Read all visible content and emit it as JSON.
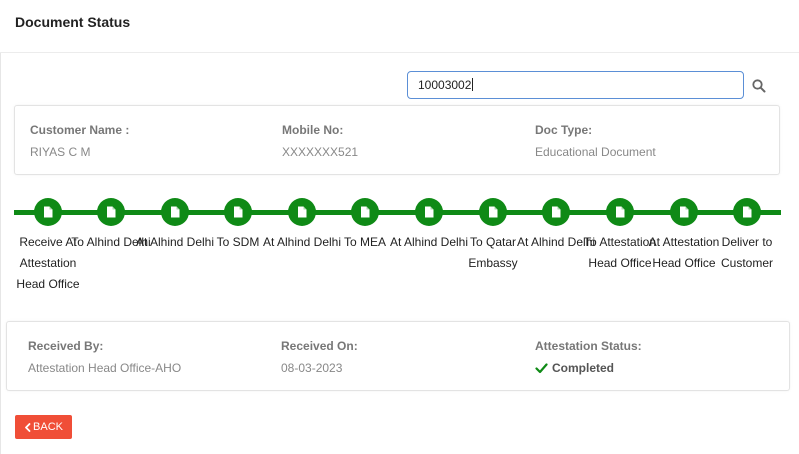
{
  "header": {
    "title": "Document Status"
  },
  "search": {
    "value": "10003002",
    "icon": "search-icon"
  },
  "customer": {
    "name_label": "Customer Name :",
    "name_value": "RIYAS C M",
    "mobile_label": "Mobile No:",
    "mobile_value": "XXXXXXX521",
    "doctype_label": "Doc Type:",
    "doctype_value": "Educational Document"
  },
  "tracker": {
    "accent_color": "#0f8a16",
    "step_icon": "document-icon",
    "steps": [
      {
        "label": "Receive At Attestation Head Office",
        "completed": true
      },
      {
        "label": "To Alhind Delhi",
        "completed": true
      },
      {
        "label": "At Alhind Delhi",
        "completed": true
      },
      {
        "label": "To SDM",
        "completed": true
      },
      {
        "label": "At Alhind Delhi",
        "completed": true
      },
      {
        "label": "To MEA",
        "completed": true
      },
      {
        "label": "At Alhind Delhi",
        "completed": true
      },
      {
        "label": "To Qatar Embassy",
        "completed": true
      },
      {
        "label": "At Alhind Delhi",
        "completed": true
      },
      {
        "label": "To Attestation Head Office",
        "completed": true
      },
      {
        "label": "At Attestation Head Office",
        "completed": true
      },
      {
        "label": "Deliver to Customer",
        "completed": true
      }
    ]
  },
  "received": {
    "by_label": "Received By:",
    "by_value": "Attestation Head Office-AHO",
    "on_label": "Received On:",
    "on_value": "08-03-2023",
    "status_label": "Attestation Status:",
    "status_value": "Completed",
    "status_color": "#0f8a16"
  },
  "back_button": {
    "label": "BACK",
    "color": "#f04e37"
  }
}
